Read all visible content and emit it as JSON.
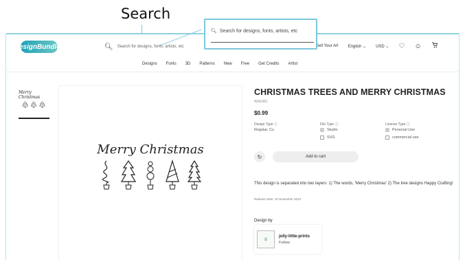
{
  "annotation": {
    "label": "Search"
  },
  "header": {
    "logo_text": "DesignBundles",
    "search_placeholder": "Search for designs, fonts, artists, etc",
    "sell_label": "Sell Your Art",
    "language_label": "English",
    "currency_label": "USD"
  },
  "popup": {
    "search_text": "Search for designs, fonts, artists, etc"
  },
  "categories": [
    "Designs",
    "Fonts",
    "3D",
    "Patterns",
    "New",
    "Free",
    "Get Credits",
    "Artist"
  ],
  "thumbnail": {
    "caption": "Merry Christmas"
  },
  "artwork": {
    "caption": "Merry Christmas"
  },
  "product": {
    "title": "CHRISTMAS TREES AND MERRY CHRISTMAS",
    "id": "4241491",
    "price": "$0.99",
    "design_type_label": "Design Type",
    "design_type_value": "Regular, Cu",
    "file_type_label": "File Type",
    "file_type_options": [
      "Studio",
      "SVG"
    ],
    "license_label": "License Type",
    "license_options": [
      "Personal Use",
      "commercial use"
    ],
    "add_to_cart": "Add to cart",
    "description": "This design is separated into two layers: 1) The words, 'Merry Christmas' 2) The tree designs Happy Crafting!",
    "release_date": "Release Date: 10 November 2024",
    "design_by_label": "Design by",
    "designer_name": "jolly-little-prints",
    "follow_label": "Follow"
  }
}
